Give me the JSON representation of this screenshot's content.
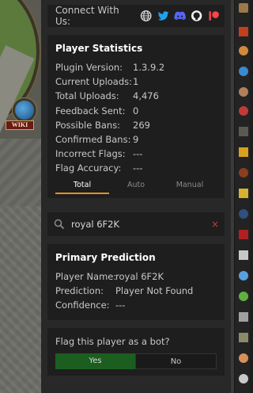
{
  "connect": {
    "label": "Connect With Us:",
    "icons": [
      "web-globe-icon",
      "twitter-icon",
      "discord-icon",
      "github-icon",
      "patreon-icon"
    ]
  },
  "stats": {
    "title": "Player Statistics",
    "rows": [
      {
        "key": "Plugin Version:",
        "value": "1.3.9.2"
      },
      {
        "key": "Current Uploads:",
        "value": "1"
      },
      {
        "key": "Total Uploads:",
        "value": "4,476"
      },
      {
        "key": "Feedback Sent:",
        "value": "0"
      },
      {
        "key": "Possible Bans:",
        "value": "269"
      },
      {
        "key": "Confirmed Bans:",
        "value": "9"
      },
      {
        "key": "Incorrect Flags:",
        "value": "---"
      },
      {
        "key": "Flag Accuracy:",
        "value": "---"
      }
    ],
    "tabs": [
      "Total",
      "Auto",
      "Manual"
    ],
    "active_tab": "Total"
  },
  "search": {
    "value": "royal 6F2K",
    "clear": "×"
  },
  "prediction": {
    "title": "Primary Prediction",
    "rows": [
      {
        "key": "Player Name:",
        "value": "royal 6F2K"
      },
      {
        "key": "Prediction:",
        "value": "Player Not Found"
      },
      {
        "key": "Confidence:",
        "value": "---"
      }
    ]
  },
  "flag": {
    "question": "Flag this player as a bot?",
    "yes": "Yes",
    "no": "No"
  },
  "game": {
    "wiki_label": "WIKI"
  },
  "colors": {
    "accent": "#e7901a",
    "yes_button": "#1b5e20",
    "clear": "#c33a3a",
    "twitter": "#1da1f2",
    "discord": "#5865f2",
    "patreon": "#ff424d"
  }
}
